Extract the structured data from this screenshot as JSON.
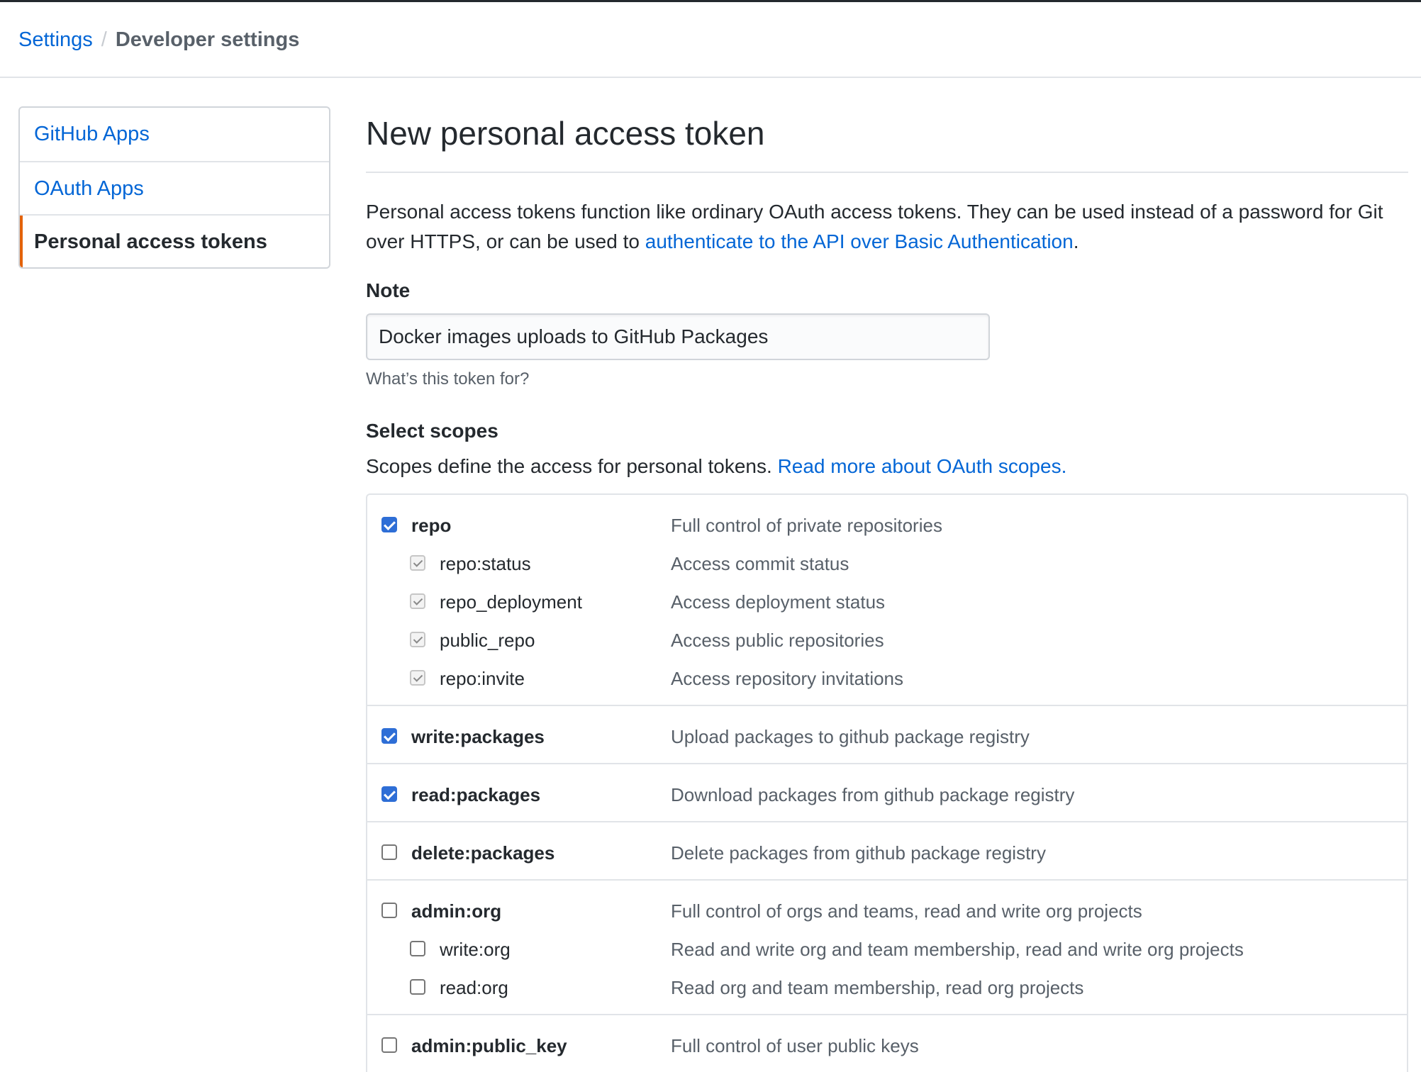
{
  "breadcrumb": {
    "settings": "Settings",
    "separator": "/",
    "current": "Developer settings"
  },
  "sidebar": {
    "items": [
      {
        "label": "GitHub Apps",
        "selected": false
      },
      {
        "label": "OAuth Apps",
        "selected": false
      },
      {
        "label": "Personal access tokens",
        "selected": true
      }
    ]
  },
  "main": {
    "title": "New personal access token",
    "intro_text": "Personal access tokens function like ordinary OAuth access tokens. They can be used instead of a password for Git over HTTPS, or can be used to ",
    "intro_link": "authenticate to the API over Basic Authentication",
    "intro_end": ".",
    "note_label": "Note",
    "note_value": "Docker images uploads to GitHub Packages",
    "note_hint": "What’s this token for?",
    "scopes_label": "Select scopes",
    "scopes_desc": "Scopes define the access for personal tokens. ",
    "scopes_link": "Read more about OAuth scopes."
  },
  "scopes": [
    {
      "name": "repo",
      "desc": "Full control of private repositories",
      "state": "checked",
      "children": [
        {
          "name": "repo:status",
          "desc": "Access commit status",
          "state": "implied"
        },
        {
          "name": "repo_deployment",
          "desc": "Access deployment status",
          "state": "implied"
        },
        {
          "name": "public_repo",
          "desc": "Access public repositories",
          "state": "implied"
        },
        {
          "name": "repo:invite",
          "desc": "Access repository invitations",
          "state": "implied"
        }
      ]
    },
    {
      "name": "write:packages",
      "desc": "Upload packages to github package registry",
      "state": "checked",
      "children": []
    },
    {
      "name": "read:packages",
      "desc": "Download packages from github package registry",
      "state": "checked",
      "children": []
    },
    {
      "name": "delete:packages",
      "desc": "Delete packages from github package registry",
      "state": "unchecked",
      "children": []
    },
    {
      "name": "admin:org",
      "desc": "Full control of orgs and teams, read and write org projects",
      "state": "unchecked",
      "children": [
        {
          "name": "write:org",
          "desc": "Read and write org and team membership, read and write org projects",
          "state": "unchecked"
        },
        {
          "name": "read:org",
          "desc": "Read org and team membership, read org projects",
          "state": "unchecked"
        }
      ]
    },
    {
      "name": "admin:public_key",
      "desc": "Full control of user public keys",
      "state": "unchecked",
      "children": []
    }
  ],
  "colors": {
    "link": "#0366d6",
    "checkbox_checked": "#2e6ed6",
    "selected_indicator": "#e36209"
  }
}
